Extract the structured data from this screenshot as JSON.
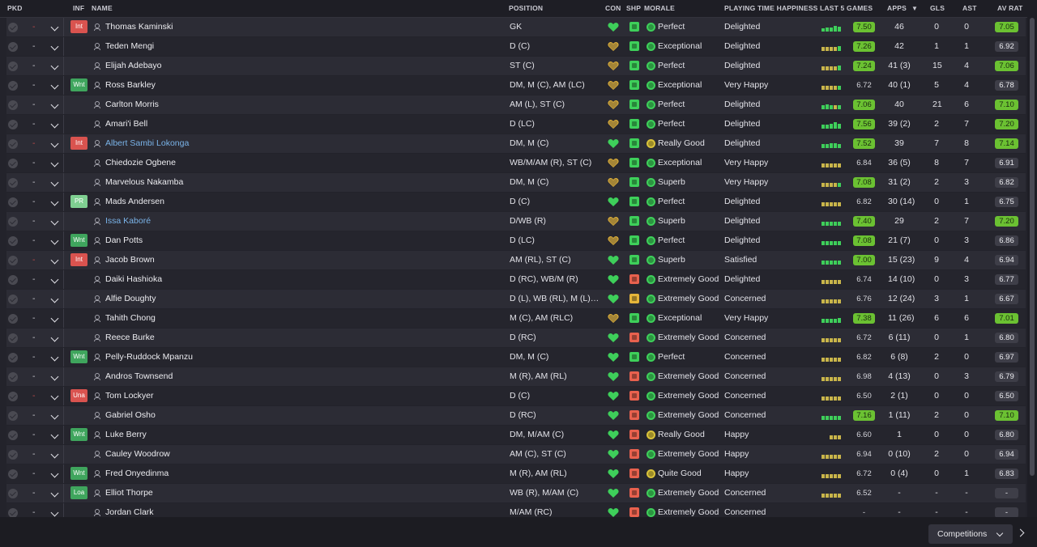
{
  "headers": {
    "pkd": "PKD",
    "inf": "INF",
    "name": "NAME",
    "position": "POSITION",
    "con": "CON",
    "shp": "SHP",
    "morale": "MORALE",
    "playing_time": "PLAYING TIME HAPPINESS",
    "last5": "LAST 5 GAMES",
    "apps": "APPS",
    "gls": "GLS",
    "ast": "AST",
    "avrat": "AV RAT"
  },
  "sort_icon": "sort-desc-icon",
  "colors": {
    "rating_high": "#6bc132",
    "rating_low": "#3e3e48",
    "injury_tag": "#d9534f",
    "want_tag": "#3fa55d",
    "link_name": "#7ab3e8"
  },
  "players": [
    {
      "dash": "-",
      "dash_red": true,
      "inf": "Int",
      "name": "Thomas Kaminski",
      "link": false,
      "position": "GK",
      "con": "full",
      "ship": "good",
      "morale_icon": "g",
      "morale": "Perfect",
      "pth": "Delighted",
      "l5_bars": [
        0.5,
        0.6,
        0.6,
        0.9,
        0.7
      ],
      "l5_bar_colors": [
        "g",
        "g",
        "g",
        "g",
        "g"
      ],
      "l5": "7.50",
      "l5_hi": true,
      "apps": "46",
      "gls": "0",
      "ast": "0",
      "avrat": "7.05",
      "avr_hi": true
    },
    {
      "dash": "-",
      "dash_red": false,
      "inf": "",
      "name": "Teden Mengi",
      "link": false,
      "position": "D (C)",
      "con": "warn",
      "ship": "good",
      "morale_icon": "g",
      "morale": "Exceptional",
      "pth": "Delighted",
      "l5_bars": [
        0.6,
        0.6,
        0.6,
        0.6,
        0.7
      ],
      "l5_bar_colors": [
        "y",
        "y",
        "y",
        "y",
        "g"
      ],
      "l5": "7.26",
      "l5_hi": true,
      "apps": "42",
      "gls": "1",
      "ast": "1",
      "avrat": "6.92",
      "avr_hi": false
    },
    {
      "dash": "-",
      "dash_red": false,
      "inf": "",
      "name": "Elijah Adebayo",
      "link": false,
      "position": "ST (C)",
      "con": "warn",
      "ship": "good",
      "morale_icon": "g",
      "morale": "Perfect",
      "pth": "Delighted",
      "l5_bars": [
        0.6,
        0.6,
        0.6,
        0.6,
        0.8
      ],
      "l5_bar_colors": [
        "y",
        "y",
        "y",
        "y",
        "g"
      ],
      "l5": "7.24",
      "l5_hi": true,
      "apps": "41 (3)",
      "gls": "15",
      "ast": "4",
      "avrat": "7.06",
      "avr_hi": true
    },
    {
      "dash": "-",
      "dash_red": false,
      "inf": "Wnt",
      "name": "Ross Barkley",
      "link": false,
      "position": "DM, M (C), AM (LC)",
      "con": "warn",
      "ship": "good",
      "morale_icon": "g",
      "morale": "Exceptional",
      "pth": "Very Happy",
      "l5_bars": [
        0.6,
        0.6,
        0.6,
        0.6,
        0.6
      ],
      "l5_bar_colors": [
        "y",
        "y",
        "y",
        "y",
        "g"
      ],
      "l5": "6.72",
      "l5_hi": false,
      "apps": "40 (1)",
      "gls": "5",
      "ast": "4",
      "avrat": "6.78",
      "avr_hi": false
    },
    {
      "dash": "-",
      "dash_red": false,
      "inf": "",
      "name": "Carlton Morris",
      "link": false,
      "position": "AM (L), ST (C)",
      "con": "warn",
      "ship": "good",
      "morale_icon": "g",
      "morale": "Perfect",
      "pth": "Delighted",
      "l5_bars": [
        0.6,
        0.7,
        0.6,
        0.6,
        0.6
      ],
      "l5_bar_colors": [
        "g",
        "g",
        "g",
        "y",
        "g"
      ],
      "l5": "7.06",
      "l5_hi": true,
      "apps": "40",
      "gls": "21",
      "ast": "6",
      "avrat": "7.10",
      "avr_hi": true
    },
    {
      "dash": "-",
      "dash_red": false,
      "inf": "",
      "name": "Amari'i Bell",
      "link": false,
      "position": "D (LC)",
      "con": "warn",
      "ship": "good",
      "morale_icon": "g",
      "morale": "Perfect",
      "pth": "Delighted",
      "l5_bars": [
        0.6,
        0.6,
        0.7,
        1.0,
        0.7
      ],
      "l5_bar_colors": [
        "g",
        "g",
        "g",
        "g",
        "g"
      ],
      "l5": "7.56",
      "l5_hi": true,
      "apps": "39 (2)",
      "gls": "2",
      "ast": "7",
      "avrat": "7.20",
      "avr_hi": true
    },
    {
      "dash": "-",
      "dash_red": true,
      "inf": "Int",
      "name": "Albert Sambi Lokonga",
      "link": true,
      "position": "DM, M (C)",
      "con": "full",
      "ship": "good",
      "morale_icon": "y",
      "morale": "Really Good",
      "pth": "Delighted",
      "l5_bars": [
        0.6,
        0.6,
        0.7,
        0.7,
        0.6
      ],
      "l5_bar_colors": [
        "g",
        "g",
        "g",
        "g",
        "g"
      ],
      "l5": "7.52",
      "l5_hi": true,
      "apps": "39",
      "gls": "7",
      "ast": "8",
      "avrat": "7.14",
      "avr_hi": true
    },
    {
      "dash": "-",
      "dash_red": false,
      "inf": "",
      "name": "Chiedozie Ogbene",
      "link": false,
      "position": "WB/M/AM (R), ST (C)",
      "con": "warn",
      "ship": "good",
      "morale_icon": "g",
      "morale": "Exceptional",
      "pth": "Very Happy",
      "l5_bars": [
        0.6,
        0.6,
        0.6,
        0.6,
        0.6
      ],
      "l5_bar_colors": [
        "y",
        "y",
        "y",
        "y",
        "y"
      ],
      "l5": "6.84",
      "l5_hi": false,
      "apps": "36 (5)",
      "gls": "8",
      "ast": "7",
      "avrat": "6.91",
      "avr_hi": false
    },
    {
      "dash": "-",
      "dash_red": false,
      "inf": "",
      "name": "Marvelous Nakamba",
      "link": false,
      "position": "DM, M (C)",
      "con": "warn",
      "ship": "good",
      "morale_icon": "g",
      "morale": "Superb",
      "pth": "Very Happy",
      "l5_bars": [
        0.6,
        0.6,
        0.6,
        0.6,
        0.6
      ],
      "l5_bar_colors": [
        "y",
        "y",
        "y",
        "y",
        "g"
      ],
      "l5": "7.08",
      "l5_hi": true,
      "apps": "31 (2)",
      "gls": "2",
      "ast": "3",
      "avrat": "6.82",
      "avr_hi": false
    },
    {
      "dash": "-",
      "dash_red": false,
      "inf": "PR",
      "name": "Mads Andersen",
      "link": false,
      "position": "D (C)",
      "con": "full",
      "ship": "good",
      "morale_icon": "g",
      "morale": "Perfect",
      "pth": "Delighted",
      "l5_bars": [
        0.6,
        0.6,
        0.6,
        0.6,
        0.6
      ],
      "l5_bar_colors": [
        "y",
        "y",
        "y",
        "y",
        "y"
      ],
      "l5": "6.82",
      "l5_hi": false,
      "apps": "30 (14)",
      "gls": "0",
      "ast": "1",
      "avrat": "6.75",
      "avr_hi": false
    },
    {
      "dash": "-",
      "dash_red": false,
      "inf": "",
      "name": "Issa Kaboré",
      "link": true,
      "position": "D/WB (R)",
      "con": "warn",
      "ship": "good",
      "morale_icon": "g",
      "morale": "Superb",
      "pth": "Delighted",
      "l5_bars": [
        0.6,
        0.6,
        0.6,
        0.6,
        0.6
      ],
      "l5_bar_colors": [
        "g",
        "g",
        "g",
        "g",
        "g"
      ],
      "l5": "7.40",
      "l5_hi": true,
      "apps": "29",
      "gls": "2",
      "ast": "7",
      "avrat": "7.20",
      "avr_hi": true
    },
    {
      "dash": "-",
      "dash_red": false,
      "inf": "Wnt",
      "name": "Dan Potts",
      "link": false,
      "position": "D (LC)",
      "con": "warn",
      "ship": "good",
      "morale_icon": "g",
      "morale": "Perfect",
      "pth": "Delighted",
      "l5_bars": [
        0.6,
        0.6,
        0.6,
        0.6,
        0.6
      ],
      "l5_bar_colors": [
        "g",
        "g",
        "g",
        "g",
        "g"
      ],
      "l5": "7.08",
      "l5_hi": true,
      "apps": "21 (7)",
      "gls": "0",
      "ast": "3",
      "avrat": "6.86",
      "avr_hi": false
    },
    {
      "dash": "-",
      "dash_red": true,
      "inf": "Int",
      "name": "Jacob Brown",
      "link": false,
      "position": "AM (RL), ST (C)",
      "con": "full",
      "ship": "good",
      "morale_icon": "g",
      "morale": "Superb",
      "pth": "Satisfied",
      "l5_bars": [
        0.6,
        0.6,
        0.6,
        0.6,
        0.6
      ],
      "l5_bar_colors": [
        "g",
        "g",
        "g",
        "g",
        "g"
      ],
      "l5": "7.00",
      "l5_hi": true,
      "apps": "15 (23)",
      "gls": "9",
      "ast": "4",
      "avrat": "6.94",
      "avr_hi": false
    },
    {
      "dash": "-",
      "dash_red": false,
      "inf": "",
      "name": "Daiki Hashioka",
      "link": false,
      "position": "D (RC), WB/M (R)",
      "con": "full",
      "ship": "bad",
      "morale_icon": "g",
      "morale": "Extremely Good",
      "pth": "Delighted",
      "l5_bars": [
        0.6,
        0.6,
        0.6,
        0.6,
        0.6
      ],
      "l5_bar_colors": [
        "y",
        "y",
        "y",
        "y",
        "y"
      ],
      "l5": "6.74",
      "l5_hi": false,
      "apps": "14 (10)",
      "gls": "0",
      "ast": "3",
      "avrat": "6.77",
      "avr_hi": false
    },
    {
      "dash": "-",
      "dash_red": false,
      "inf": "",
      "name": "Alfie Doughty",
      "link": false,
      "position": "D (L), WB (RL), M (L), AM (L)",
      "con": "full",
      "ship": "warn",
      "morale_icon": "g",
      "morale": "Extremely Good",
      "pth": "Concerned",
      "l5_bars": [
        0.6,
        0.6,
        0.6,
        0.6,
        0.6
      ],
      "l5_bar_colors": [
        "y",
        "y",
        "y",
        "y",
        "y"
      ],
      "l5": "6.76",
      "l5_hi": false,
      "apps": "12 (24)",
      "gls": "3",
      "ast": "1",
      "avrat": "6.67",
      "avr_hi": false
    },
    {
      "dash": "-",
      "dash_red": false,
      "inf": "",
      "name": "Tahith Chong",
      "link": false,
      "position": "M (C), AM (RLC)",
      "con": "warn",
      "ship": "good",
      "morale_icon": "g",
      "morale": "Exceptional",
      "pth": "Very Happy",
      "l5_bars": [
        0.6,
        0.6,
        0.6,
        0.6,
        0.8
      ],
      "l5_bar_colors": [
        "g",
        "g",
        "g",
        "g",
        "g"
      ],
      "l5": "7.38",
      "l5_hi": true,
      "apps": "11 (26)",
      "gls": "6",
      "ast": "6",
      "avrat": "7.01",
      "avr_hi": true
    },
    {
      "dash": "-",
      "dash_red": false,
      "inf": "",
      "name": "Reece Burke",
      "link": false,
      "position": "D (RC)",
      "con": "full",
      "ship": "bad",
      "morale_icon": "g",
      "morale": "Extremely Good",
      "pth": "Concerned",
      "l5_bars": [
        0.6,
        0.6,
        0.6,
        0.6,
        0.6
      ],
      "l5_bar_colors": [
        "y",
        "y",
        "y",
        "y",
        "y"
      ],
      "l5": "6.72",
      "l5_hi": false,
      "apps": "6 (11)",
      "gls": "0",
      "ast": "1",
      "avrat": "6.80",
      "avr_hi": false
    },
    {
      "dash": "-",
      "dash_red": false,
      "inf": "Wnt",
      "name": "Pelly-Ruddock Mpanzu",
      "link": false,
      "position": "DM, M (C)",
      "con": "full",
      "ship": "good",
      "morale_icon": "g",
      "morale": "Perfect",
      "pth": "Concerned",
      "l5_bars": [
        0.6,
        0.6,
        0.6,
        0.6,
        0.6
      ],
      "l5_bar_colors": [
        "y",
        "y",
        "y",
        "y",
        "y"
      ],
      "l5": "6.82",
      "l5_hi": false,
      "apps": "6 (8)",
      "gls": "2",
      "ast": "0",
      "avrat": "6.97",
      "avr_hi": false
    },
    {
      "dash": "-",
      "dash_red": false,
      "inf": "",
      "name": "Andros Townsend",
      "link": false,
      "position": "M (R), AM (RL)",
      "con": "full",
      "ship": "bad",
      "morale_icon": "g",
      "morale": "Extremely Good",
      "pth": "Concerned",
      "l5_bars": [
        0.6,
        0.6,
        0.6,
        0.6,
        0.6
      ],
      "l5_bar_colors": [
        "y",
        "y",
        "y",
        "y",
        "y"
      ],
      "l5": "6.98",
      "l5_hi": false,
      "apps": "4 (13)",
      "gls": "0",
      "ast": "3",
      "avrat": "6.79",
      "avr_hi": false
    },
    {
      "dash": "-",
      "dash_red": true,
      "inf": "Una",
      "name": "Tom Lockyer",
      "link": false,
      "position": "D (C)",
      "con": "full",
      "ship": "bad",
      "morale_icon": "g",
      "morale": "Extremely Good",
      "pth": "Concerned",
      "l5_bars": [
        0.6,
        0.6,
        0.6,
        0.6,
        0.6
      ],
      "l5_bar_colors": [
        "y",
        "y",
        "y",
        "y",
        "y"
      ],
      "l5": "6.50",
      "l5_hi": false,
      "apps": "2 (1)",
      "gls": "0",
      "ast": "0",
      "avrat": "6.50",
      "avr_hi": false
    },
    {
      "dash": "-",
      "dash_red": false,
      "inf": "",
      "name": "Gabriel Osho",
      "link": false,
      "position": "D (RC)",
      "con": "full",
      "ship": "bad",
      "morale_icon": "g",
      "morale": "Extremely Good",
      "pth": "Concerned",
      "l5_bars": [
        0.6,
        0.6,
        0.6,
        0.6,
        0.6
      ],
      "l5_bar_colors": [
        "g",
        "g",
        "g",
        "g",
        "g"
      ],
      "l5": "7.16",
      "l5_hi": true,
      "apps": "1 (11)",
      "gls": "2",
      "ast": "0",
      "avrat": "7.10",
      "avr_hi": true
    },
    {
      "dash": "-",
      "dash_red": false,
      "inf": "Wnt",
      "name": "Luke Berry",
      "link": false,
      "position": "DM, M/AM (C)",
      "con": "full",
      "ship": "bad",
      "morale_icon": "y",
      "morale": "Really Good",
      "pth": "Happy",
      "l5_bars": [
        0,
        0,
        0.6,
        0.6,
        0.6
      ],
      "l5_bar_colors": [
        "y",
        "y",
        "y",
        "y",
        "y"
      ],
      "l5": "6.60",
      "l5_hi": false,
      "apps": "1",
      "gls": "0",
      "ast": "0",
      "avrat": "6.80",
      "avr_hi": false
    },
    {
      "dash": "-",
      "dash_red": false,
      "inf": "",
      "name": "Cauley Woodrow",
      "link": false,
      "position": "AM (C), ST (C)",
      "con": "full",
      "ship": "bad",
      "morale_icon": "g",
      "morale": "Extremely Good",
      "pth": "Happy",
      "l5_bars": [
        0.6,
        0.6,
        0.6,
        0.6,
        0.6
      ],
      "l5_bar_colors": [
        "y",
        "y",
        "y",
        "y",
        "y"
      ],
      "l5": "6.94",
      "l5_hi": false,
      "apps": "0 (10)",
      "gls": "2",
      "ast": "0",
      "avrat": "6.94",
      "avr_hi": false
    },
    {
      "dash": "-",
      "dash_red": false,
      "inf": "Wnt",
      "name": "Fred Onyedinma",
      "link": false,
      "position": "M (R), AM (RL)",
      "con": "full",
      "ship": "bad",
      "morale_icon": "y",
      "morale": "Quite Good",
      "pth": "Happy",
      "l5_bars": [
        0.6,
        0.6,
        0.6,
        0.6,
        0.6
      ],
      "l5_bar_colors": [
        "y",
        "y",
        "y",
        "y",
        "y"
      ],
      "l5": "6.72",
      "l5_hi": false,
      "apps": "0 (4)",
      "gls": "0",
      "ast": "1",
      "avrat": "6.83",
      "avr_hi": false
    },
    {
      "dash": "-",
      "dash_red": false,
      "inf": "Loa",
      "name": "Elliot Thorpe",
      "link": false,
      "position": "WB (R), M/AM (C)",
      "con": "full",
      "ship": "bad",
      "morale_icon": "g",
      "morale": "Extremely Good",
      "pth": "Concerned",
      "l5_bars": [
        0.6,
        0.6,
        0.6,
        0.6,
        0.6
      ],
      "l5_bar_colors": [
        "y",
        "y",
        "y",
        "y",
        "y"
      ],
      "l5": "6.52",
      "l5_hi": false,
      "apps": "-",
      "gls": "-",
      "ast": "-",
      "avrat": "-",
      "avr_hi": false
    },
    {
      "dash": "-",
      "dash_red": false,
      "inf": "",
      "name": "Jordan Clark",
      "link": false,
      "position": "M/AM (RC)",
      "con": "full",
      "ship": "bad",
      "morale_icon": "g",
      "morale": "Extremely Good",
      "pth": "Concerned",
      "l5_bars": [
        0,
        0,
        0,
        0,
        0
      ],
      "l5_bar_colors": [
        "y",
        "y",
        "y",
        "y",
        "y"
      ],
      "l5": "-",
      "l5_hi": false,
      "apps": "-",
      "gls": "-",
      "ast": "-",
      "avrat": "-",
      "avr_hi": false
    }
  ],
  "footer": {
    "competitions_label": "Competitions",
    "competitions_icon": "chevron-down-icon",
    "next_icon": "chevron-right-icon"
  }
}
